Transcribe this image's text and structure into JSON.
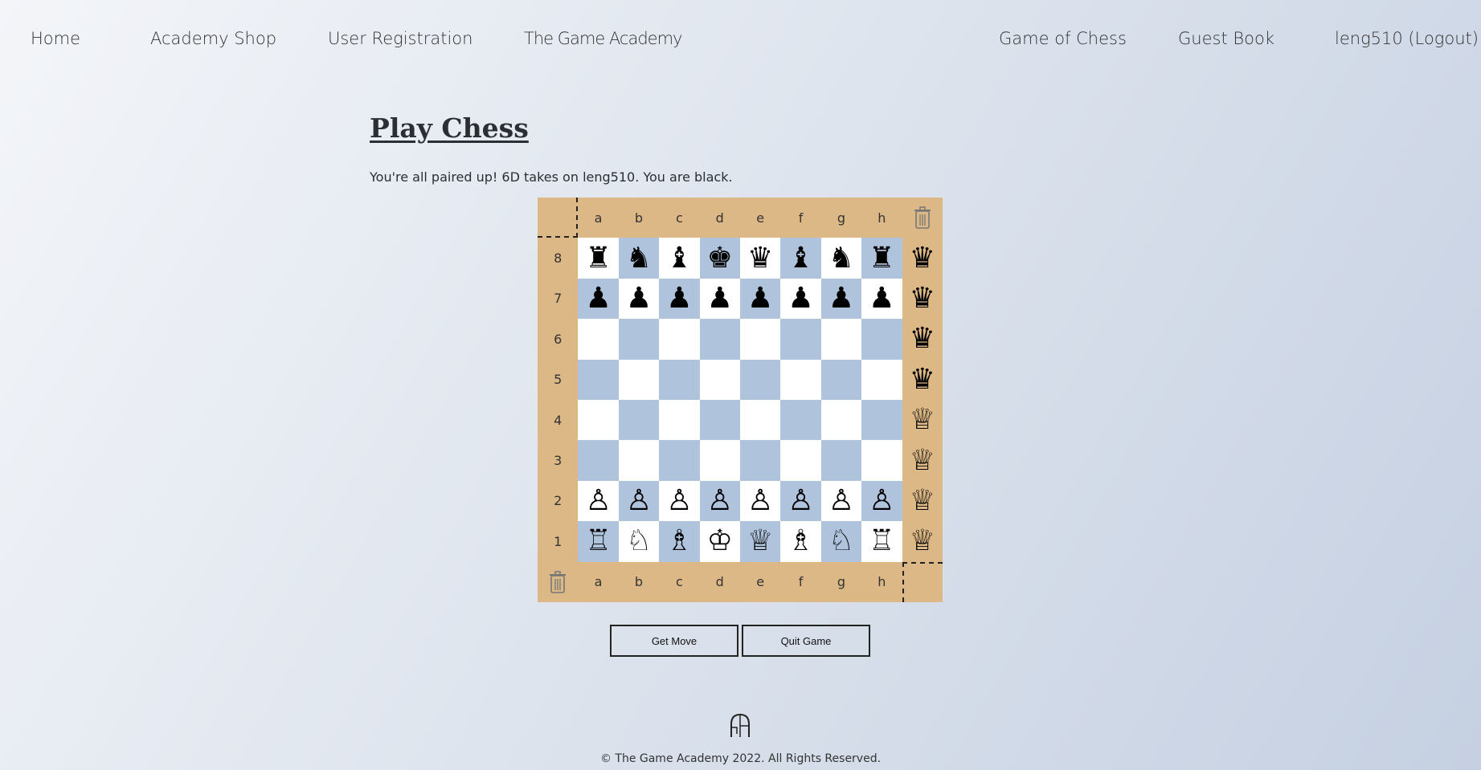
{
  "nav": {
    "home": "Home",
    "shop": "Academy Shop",
    "registration": "User Registration",
    "brand": "The Game Academy",
    "chess": "Game of Chess",
    "guestbook": "Guest Book",
    "user": "leng510 (Logout)"
  },
  "main": {
    "title": "Play Chess",
    "status": "You're all paired up! 6D takes on leng510. You are black."
  },
  "board": {
    "files": [
      "a",
      "b",
      "c",
      "d",
      "e",
      "f",
      "g",
      "h"
    ],
    "ranks": [
      "8",
      "7",
      "6",
      "5",
      "4",
      "3",
      "2",
      "1"
    ],
    "rows": [
      [
        "♜",
        "♞",
        "♝",
        "♚",
        "♛",
        "♝",
        "♞",
        "♜"
      ],
      [
        "♟",
        "♟",
        "♟",
        "♟",
        "♟",
        "♟",
        "♟",
        "♟"
      ],
      [
        "",
        "",
        "",
        "",
        "",
        "",
        "",
        ""
      ],
      [
        "",
        "",
        "",
        "",
        "",
        "",
        "",
        ""
      ],
      [
        "",
        "",
        "",
        "",
        "",
        "",
        "",
        ""
      ],
      [
        "",
        "",
        "",
        "",
        "",
        "",
        "",
        ""
      ],
      [
        "♙",
        "♙",
        "♙",
        "♙",
        "♙",
        "♙",
        "♙",
        "♙"
      ],
      [
        "♖",
        "♘",
        "♗",
        "♔",
        "♕",
        "♗",
        "♘",
        "♖"
      ]
    ],
    "side_pieces": [
      "♛",
      "♛",
      "♛",
      "♛",
      "♕",
      "♕",
      "♕",
      "♕"
    ],
    "light_color": "#ffffff",
    "dark_color": "#afc3dc",
    "frame_color": "#dcb886"
  },
  "buttons": {
    "get_move": "Get Move",
    "quit_game": "Quit Game"
  },
  "footer": {
    "copyright": "© The Game Academy 2022. All Rights Reserved."
  }
}
